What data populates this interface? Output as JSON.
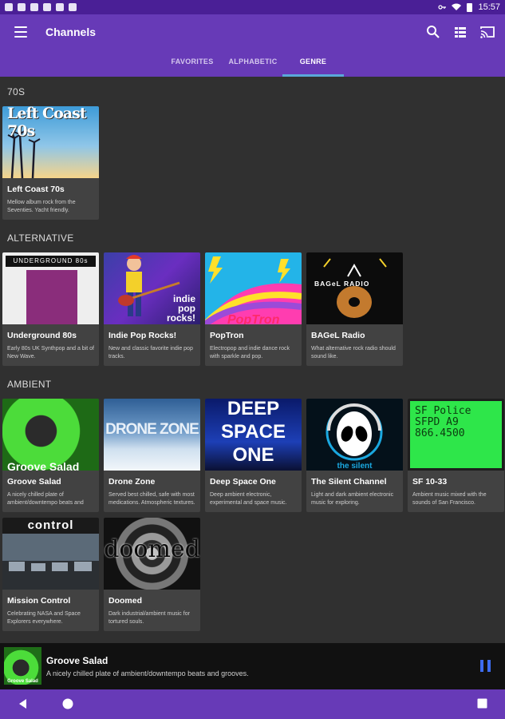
{
  "status_bar": {
    "time": "15:57"
  },
  "app_bar": {
    "title": "Channels",
    "icons": [
      "menu-icon",
      "search-icon",
      "grid-view-icon",
      "cast-icon"
    ]
  },
  "tabs": [
    {
      "label": "FAVORITES",
      "active": false
    },
    {
      "label": "ALPHABETIC",
      "active": false
    },
    {
      "label": "GENRE",
      "active": true
    }
  ],
  "sections": [
    {
      "title": "70S",
      "channels": [
        {
          "name": "Left Coast 70s",
          "desc": "Mellow album rock from the Seventies. Yacht friendly.",
          "art_text": "Left Coast 70s"
        }
      ]
    },
    {
      "title": "ALTERNATIVE",
      "channels": [
        {
          "name": "Underground 80s",
          "desc": "Early 80s UK Synthpop and a bit of New Wave.",
          "art_text": "UNDERGROUND 80s"
        },
        {
          "name": "Indie Pop Rocks!",
          "desc": "New and classic favorite indie pop tracks.",
          "art_text": "indie pop rocks!"
        },
        {
          "name": "PopTron",
          "desc": "Electropop and indie dance rock with sparkle and pop.",
          "art_text": "PopTron"
        },
        {
          "name": "BAGeL Radio",
          "desc": "What alternative rock radio should sound like.",
          "art_text": "BAGeL RADIO"
        }
      ]
    },
    {
      "title": "AMBIENT",
      "channels": [
        {
          "name": "Groove Salad",
          "desc": "A nicely chilled plate of ambient/downtempo beats and grooves.",
          "art_text": "Groove Salad"
        },
        {
          "name": "Drone Zone",
          "desc": "Served best chilled, safe with most medications. Atmospheric textures.",
          "art_text": "DRONE ZONE"
        },
        {
          "name": "Deep Space One",
          "desc": "Deep ambient electronic, experimental and space music.",
          "art_text": "DEEP SPACE ONE"
        },
        {
          "name": "The Silent Channel",
          "desc": "Light and dark ambient electronic music for exploring.",
          "art_text": "the silent"
        },
        {
          "name": "SF 10-33",
          "desc": "Ambient music mixed with the sounds of San Francisco.",
          "art_text": "SF Police SFPD A9 866.4500"
        },
        {
          "name": "Mission Control",
          "desc": "Celebrating NASA and Space Explorers everywhere.",
          "art_text": "control"
        },
        {
          "name": "Doomed",
          "desc": "Dark industrial/ambient music for tortured souls.",
          "art_text": "doomed"
        }
      ]
    }
  ],
  "now_playing": {
    "title": "Groove Salad",
    "desc": "A nicely chilled plate of ambient/downtempo beats and grooves.",
    "art_text": "Groove Salad",
    "state": "playing"
  },
  "colors": {
    "primary": "#673ab7",
    "status_bar": "#4a1f96",
    "background": "#303030",
    "card": "#424242",
    "tab_indicator": "#5aa8d9",
    "pause_button": "#3d6cf0"
  }
}
